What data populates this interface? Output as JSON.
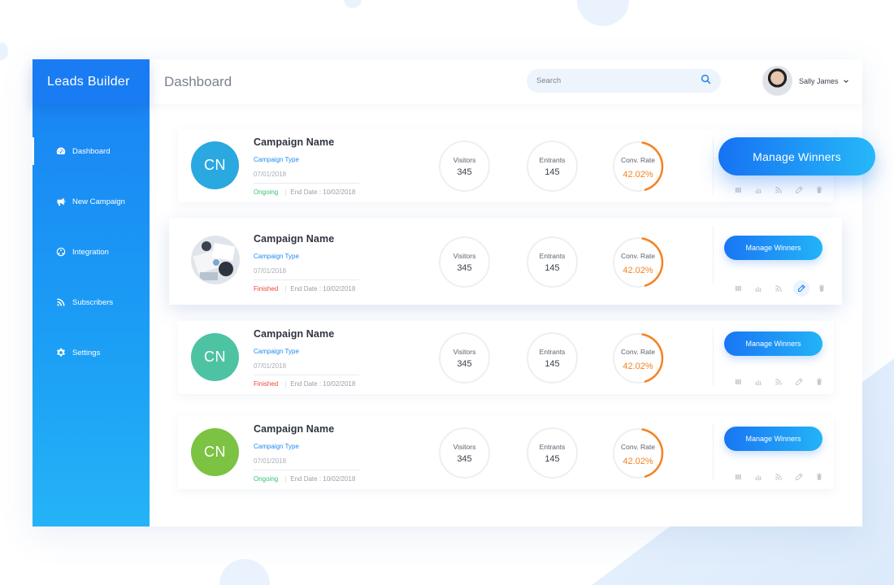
{
  "app": {
    "brand": "Leads Builder",
    "page_title": "Dashboard"
  },
  "sidebar": {
    "items": [
      {
        "label": "Dashboard",
        "icon": "dashboard-icon",
        "active": true
      },
      {
        "label": "New Campaign",
        "icon": "megaphone-icon",
        "active": false
      },
      {
        "label": "Integration",
        "icon": "integration-icon",
        "active": false
      },
      {
        "label": "Subscribers",
        "icon": "rss-icon",
        "active": false
      },
      {
        "label": "Settings",
        "icon": "gear-icon",
        "active": false
      }
    ]
  },
  "search": {
    "placeholder": "Search",
    "value": ""
  },
  "user": {
    "name": "Sally James"
  },
  "stats_labels": {
    "visitors": "Visitors",
    "entrants": "Entrants",
    "conv_rate": "Conv. Rate"
  },
  "campaigns": [
    {
      "initials": "CN",
      "avatar_color": "#2aa8e0",
      "name": "Campaign Name",
      "type": "Campaign Type",
      "date": "07/01/2018",
      "status": "Ongoing",
      "end_date": "End Date : 10/02/2018",
      "visitors": "345",
      "entrants": "145",
      "conv_rate": "42.02%",
      "conv_fraction": 0.4202,
      "button": "Manage Winners"
    },
    {
      "initials": "",
      "avatar_color": "",
      "name": "Campaign Name",
      "type": "Campaign Type",
      "date": "07/01/2018",
      "status": "Finished",
      "end_date": "End Date : 10/02/2018",
      "visitors": "345",
      "entrants": "145",
      "conv_rate": "42.02%",
      "conv_fraction": 0.4202,
      "button": "Manage Winners"
    },
    {
      "initials": "CN",
      "avatar_color": "#4dc3a4",
      "name": "Campaign Name",
      "type": "Campaign Type",
      "date": "07/01/2018",
      "status": "Finished",
      "end_date": "End Date : 10/02/2018",
      "visitors": "345",
      "entrants": "145",
      "conv_rate": "42.02%",
      "conv_fraction": 0.4202,
      "button": "Manage Winners"
    },
    {
      "initials": "CN",
      "avatar_color": "#7cc243",
      "name": "Campaign Name",
      "type": "Campaign Type",
      "date": "07/01/2018",
      "status": "Ongoing",
      "end_date": "End Date : 10/02/2018",
      "visitors": "345",
      "entrants": "145",
      "conv_rate": "42.02%",
      "conv_fraction": 0.4202,
      "button": "Manage Winners"
    }
  ],
  "highlight_button": {
    "label": "Manage Winners"
  },
  "colors": {
    "accent": "#1a82f4",
    "orange": "#f58220",
    "ongoing": "#38c172",
    "finished": "#f0453a"
  }
}
